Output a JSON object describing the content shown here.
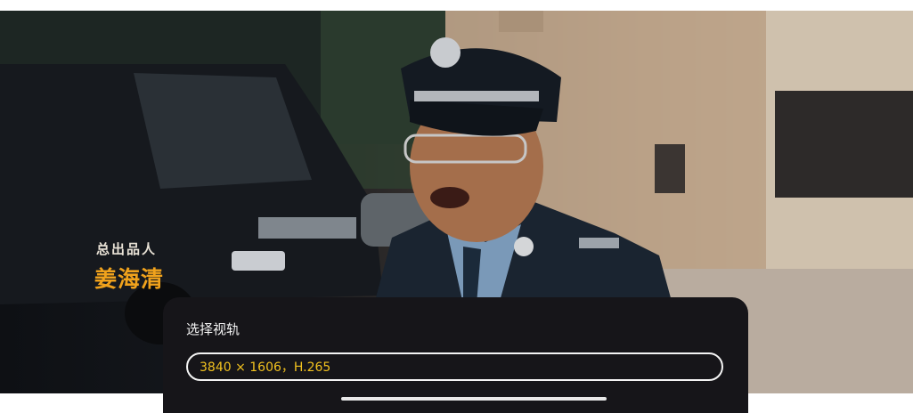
{
  "video": {
    "credit_role": "总出品人",
    "credit_name": "姜海清"
  },
  "track_sheet": {
    "title": "选择视轨",
    "options": [
      {
        "label": "3840 × 1606，H.265",
        "selected": true
      }
    ]
  },
  "colors": {
    "sheet_bg": "#161519",
    "accent": "#f2c21f",
    "credit_name": "#f0a21c"
  }
}
